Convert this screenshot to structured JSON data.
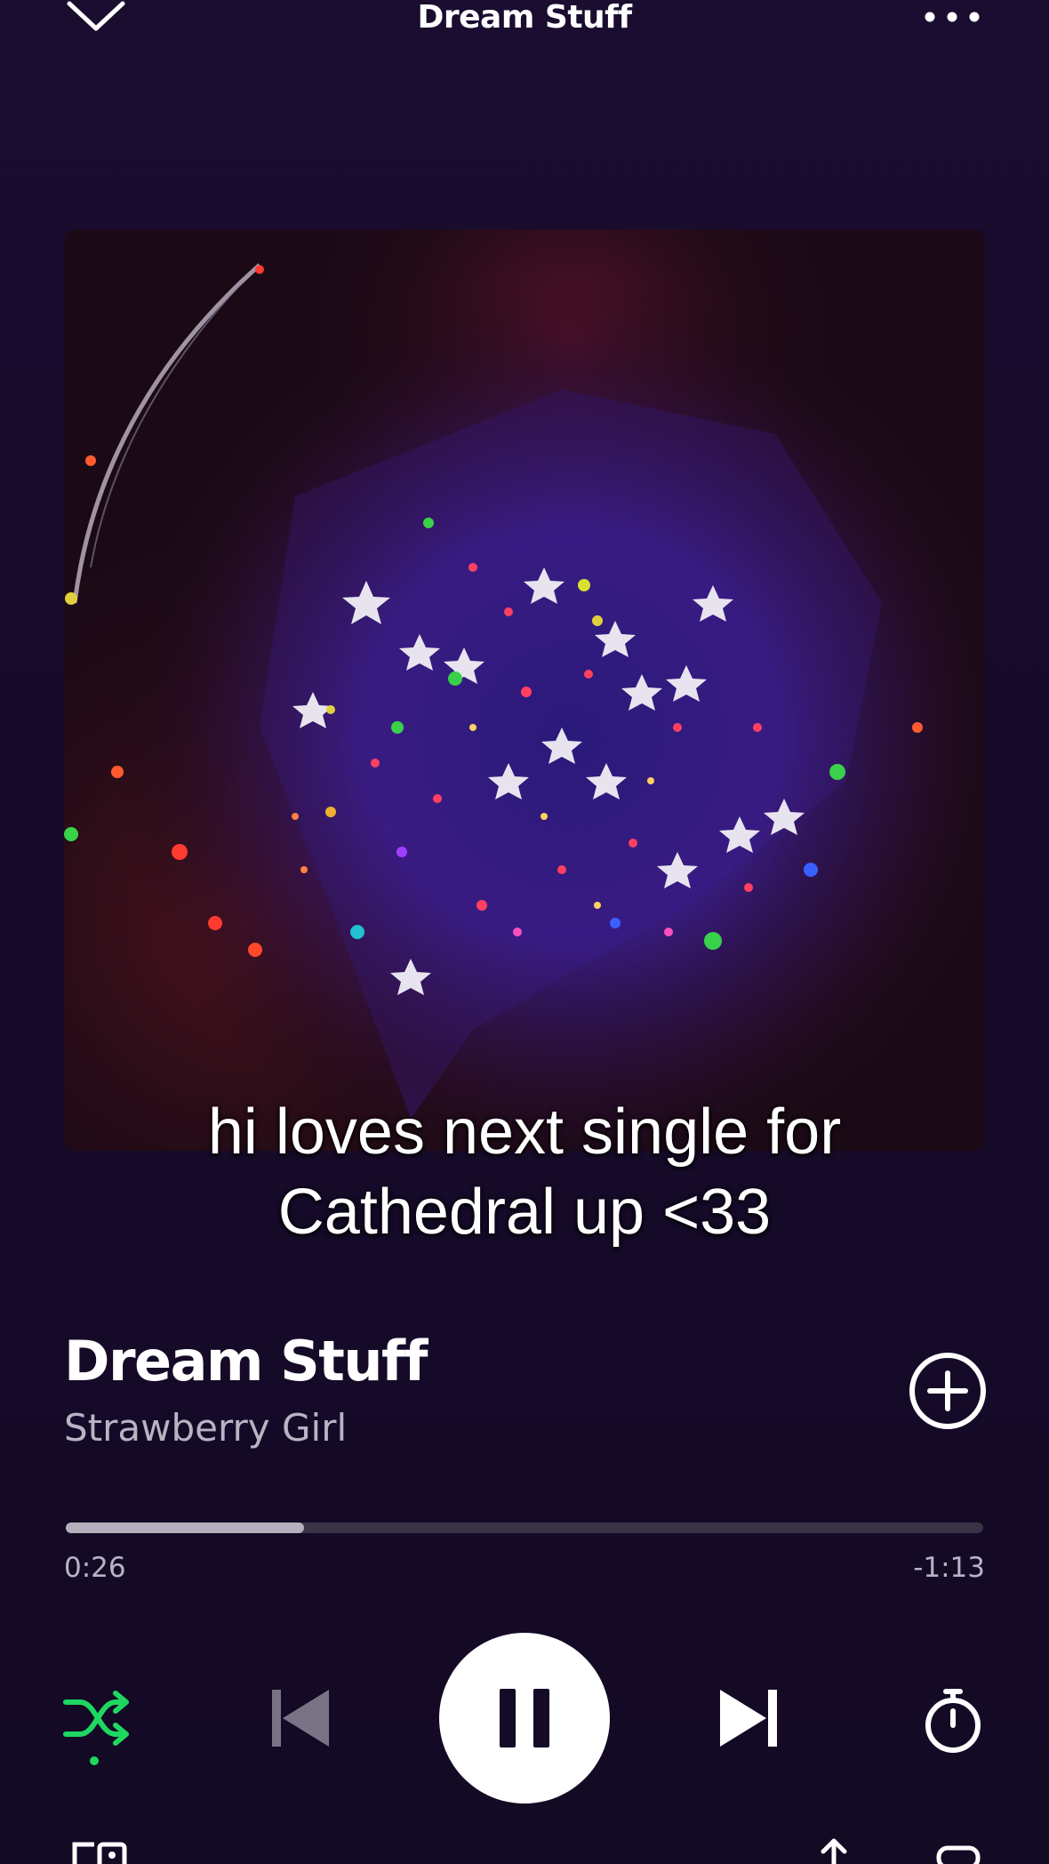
{
  "header": {
    "title": "Dream Stuff",
    "collapse_icon": "chevron-down-icon",
    "more_icon": "more-horizontal-icon"
  },
  "caption": {
    "line1": "hi loves next single for",
    "line2": "Cathedral up <33"
  },
  "track": {
    "title": "Dream Stuff",
    "artist": "Strawberry Girl",
    "add_icon": "plus-circle-icon"
  },
  "progress": {
    "elapsed": "0:26",
    "remaining": "-1:13",
    "fraction": 0.26
  },
  "controls": {
    "shuffle_icon": "shuffle-icon",
    "shuffle_active": true,
    "previous_icon": "skip-previous-icon",
    "previous_enabled": false,
    "play_state_icon": "pause-icon",
    "next_icon": "skip-next-icon",
    "timer_icon": "sleep-timer-icon"
  },
  "footer": {
    "devices_icon": "connect-device-icon",
    "share_icon": "share-icon",
    "queue_icon": "queue-icon"
  },
  "colors": {
    "background": "#170b2b",
    "accent_green": "#1ed760",
    "text_secondary": "#b9b3c4",
    "progress_fill": "#b5b0bb",
    "progress_track": "#3a3346",
    "disabled": "#7a7385"
  }
}
